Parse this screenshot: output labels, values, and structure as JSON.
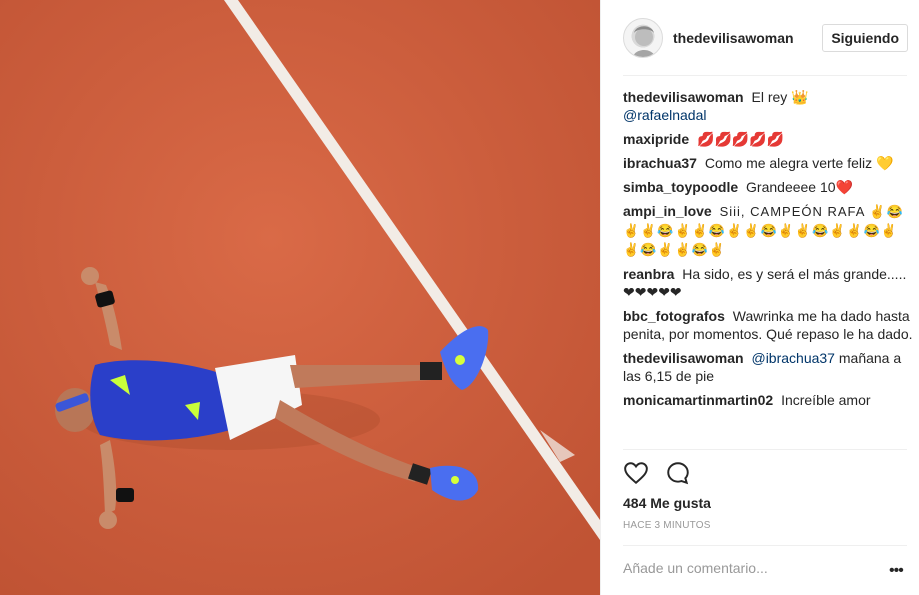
{
  "post": {
    "image_alt": "Tennis player lying on clay court celebrating",
    "author": "thedevilisawoman",
    "follow_label": "Siguiendo",
    "likes": "484 Me gusta",
    "time": "HACE 3 MINUTOS",
    "comment_placeholder": "Añade un comentario...",
    "more_label": "•••"
  },
  "comments": [
    {
      "user": "thedevilisawoman",
      "text": "El rey 👑",
      "mention": "@rafaelnadal"
    },
    {
      "user": "maxipride",
      "text": "💋💋💋💋💋"
    },
    {
      "user": "ibrachua37",
      "text": "Como me alegra verte feliz 💛"
    },
    {
      "user": "simba_toypoodle",
      "text": "Grandeeee 10❤️"
    },
    {
      "user": "ampi_in_love",
      "text": "Siii, CAMPEÓN RAFA ✌😂✌✌😂✌✌😂✌✌😂✌✌😂✌✌😂✌✌😂✌✌😂✌"
    },
    {
      "user": "reanbra",
      "text": "Ha sido, es y será el más grande.....❤❤❤❤❤"
    },
    {
      "user": "bbc_fotografos",
      "text": "Wawrinka me ha dado hasta penita, por momentos. Qué repaso le ha dado."
    },
    {
      "user": "thedevilisawoman",
      "mention": "@ibrachua37",
      "text": "mañana a las 6,15 de pie"
    },
    {
      "user": "monicamartinmartin02",
      "text": "Increíble amor"
    }
  ],
  "icons": {
    "like": "heart-icon",
    "comment": "comment-bubble-icon",
    "more": "more-options-icon"
  },
  "colors": {
    "clay": "#d5603c",
    "line": "#f4efe9",
    "shirt": "#2a3fc9",
    "text": "#262626",
    "muted": "#999999",
    "mention": "#003569"
  }
}
